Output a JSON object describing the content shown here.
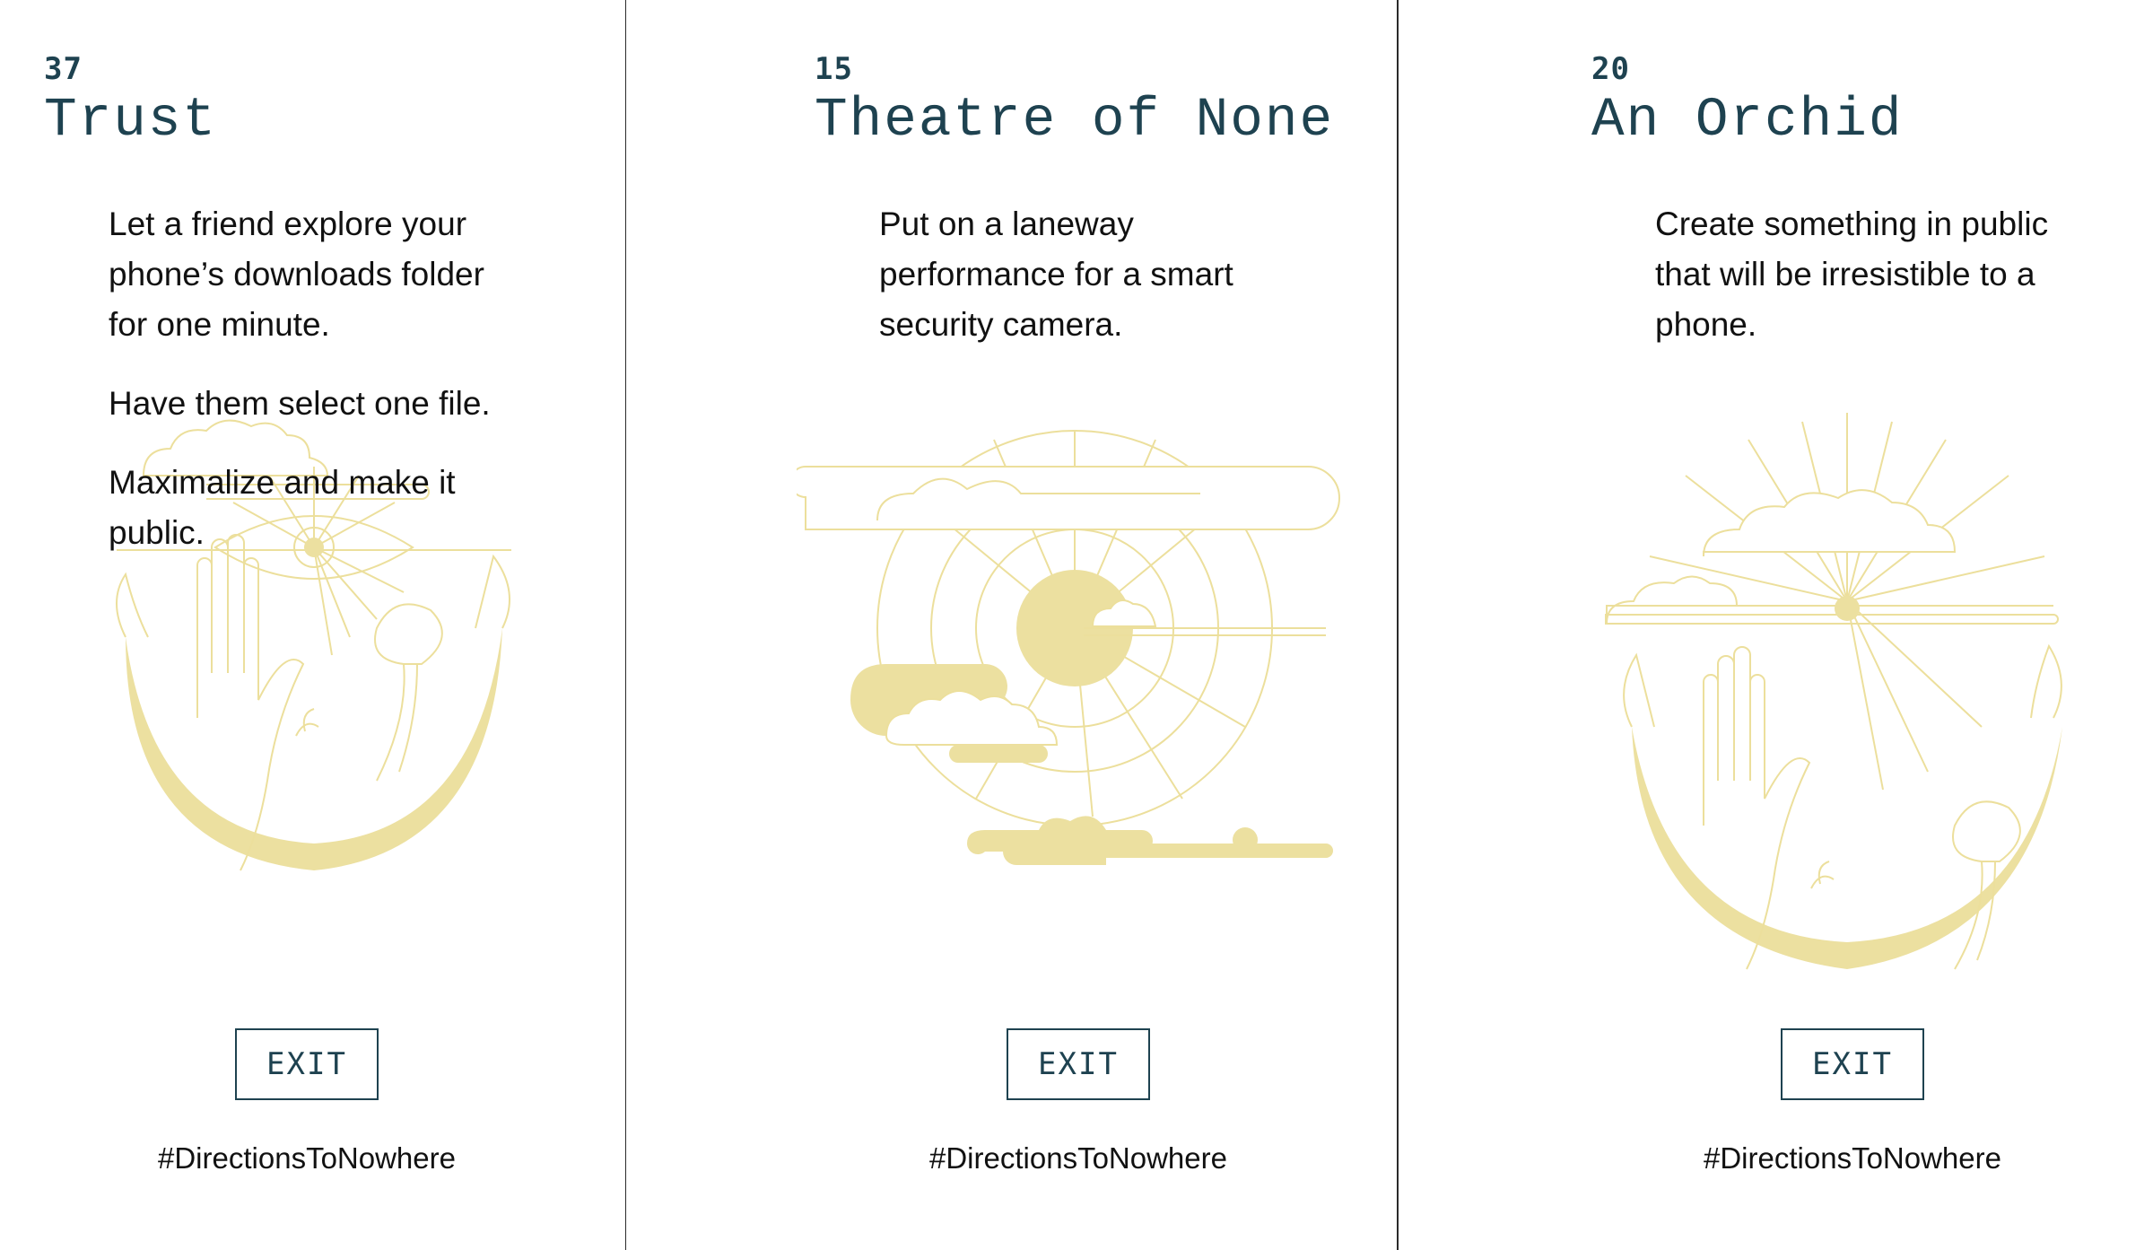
{
  "colors": {
    "accent": "#1e4250",
    "illustration": "#ece0a0",
    "text": "#111111",
    "background": "#ffffff"
  },
  "cards": [
    {
      "number": "37",
      "title": "Trust",
      "paragraphs": [
        "Let a friend explore your phone’s downloads folder for one minute.",
        "Have them select one file.",
        "Maximalize and make it public."
      ],
      "illustration": "hand-eye-moon-illustration",
      "exit_label": "EXIT",
      "hashtag": "#DirectionsToNowhere"
    },
    {
      "number": "15",
      "title": "Theatre of None",
      "paragraphs": [
        "Put on a laneway performance for a smart security camera."
      ],
      "illustration": "sun-clouds-illustration",
      "exit_label": "EXIT",
      "hashtag": "#DirectionsToNowhere"
    },
    {
      "number": "20",
      "title": "An Orchid",
      "paragraphs": [
        "Create something in public that will be irresistible to a phone."
      ],
      "illustration": "hand-moon-clouds-illustration",
      "exit_label": "EXIT",
      "hashtag": "#DirectionsToNowhere"
    }
  ]
}
